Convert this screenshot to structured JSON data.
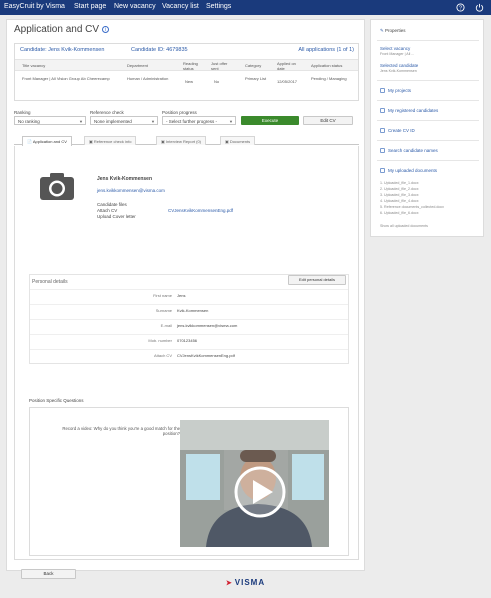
{
  "topbar": {
    "brand": "EasyCruit by Visma",
    "nav": [
      "Start page",
      "New vacancy",
      "Vacancy list",
      "Settings"
    ],
    "icons": [
      "help-icon",
      "power-icon"
    ],
    "color": "#1a3a7c"
  },
  "page": {
    "title": "Application and CV",
    "candidate_label": "Candidate: Jens Kvik-Kommensen",
    "candidate_id": "Candidate ID: 4679835",
    "all_applications": "All applications (1 of 1)"
  },
  "apps_table": {
    "headers": [
      "Title vacancy",
      "Department",
      "Reading status",
      "Just offer sent",
      "Category",
      "Applied on date",
      "Application status"
    ],
    "rows": [
      [
        "Front Manager | All Vision Group Ab Cheerecamp",
        "Human / Administration",
        "New",
        "No",
        "Primary List",
        "12/05/2017",
        "Pending / Managing"
      ]
    ]
  },
  "filters": {
    "ranking_label": "Ranking",
    "ranking_value": "No ranking",
    "reference_label": "Reference check",
    "reference_value": "None implemented",
    "position_label": "Position progress",
    "position_value": "- Select further progress -",
    "execute_label": "Execute",
    "edit_cv_label": "Edit CV"
  },
  "tabs": [
    "Application and CV",
    "Reference check info",
    "Interview Report (0)",
    "Documents"
  ],
  "candidate": {
    "name": "Jens Kvik-Kommensen",
    "email": "jens.kvikkommensen@visma.com",
    "files_label": "Candidate files",
    "attach_cv_label": "Attach CV",
    "cover_letter_label": "Upload Cover letter",
    "cv_file": "CVJensKvikKommensenEng.pdf"
  },
  "personal": {
    "title": "Personal details",
    "edit_label": "Edit personal details",
    "rows": [
      {
        "label": "First name",
        "value": "Jens"
      },
      {
        "label": "Surname",
        "value": "Kvik-Kommensen"
      },
      {
        "label": "E-mail",
        "value": "jens.kvikkommensen@visma.com"
      },
      {
        "label": "Mob. number",
        "value": "070123456"
      },
      {
        "label": "Attach CV",
        "value": "CVJensKvikKommensenEng.pdf"
      }
    ]
  },
  "questions": {
    "title": "Position Specific Questions",
    "question": "Record a video: Why do you think you're a good match for the position?"
  },
  "buttons": {
    "back": "Back"
  },
  "sidebar": {
    "properties": "Properties",
    "select_vacancy": "Select vacancy",
    "select_vacancy_sub": "Front Manager | All ...",
    "selected_candidate": "Selected candidate",
    "selected_candidate_sub": "Jens Kvik-Kommensen",
    "items": [
      "My projects",
      "My registered candidates",
      "Create CV ID",
      "Search candidate names",
      "My uploaded documents"
    ],
    "docs": [
      "1. Uploaded_file_1.docx",
      "2. Uploaded_file_2.docx",
      "3. Uploaded_file_3.docx",
      "4. Uploaded_file_4.docx",
      "5. Reference documents_collected.docx",
      "6. Uploaded_file_6.docx"
    ],
    "see_all": "Show all uploaded documents"
  },
  "footer": {
    "brand": "VISMA",
    "brand_color": "#1a3a7c",
    "mark_color": "#d11f2f"
  }
}
